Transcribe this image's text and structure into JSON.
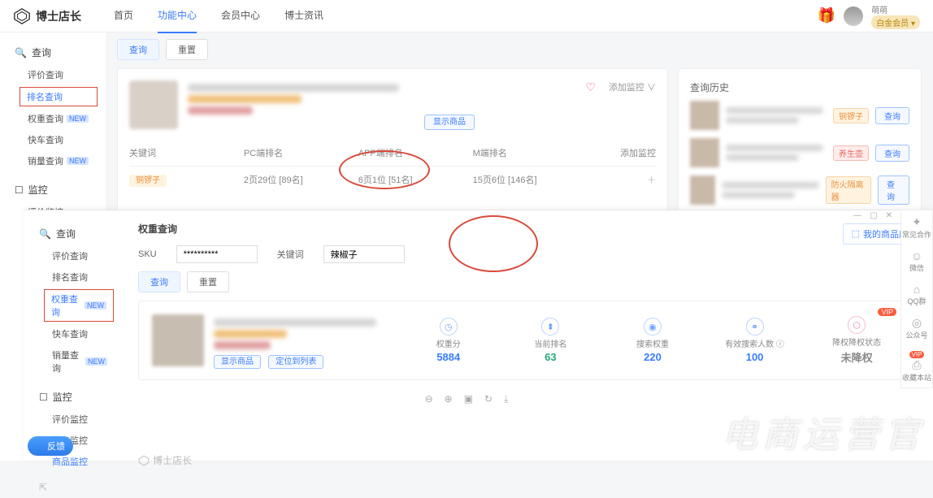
{
  "header": {
    "brand": "博士店长",
    "nav": [
      "首页",
      "功能中心",
      "会员中心",
      "博士资讯"
    ],
    "username": "萌萌",
    "member_badge": "白金会员 ▾"
  },
  "sidebar": {
    "group_query": "查询",
    "items_query": [
      {
        "label": "评价查询",
        "new": false
      },
      {
        "label": "排名查询",
        "new": false,
        "boxed": true,
        "active": true
      },
      {
        "label": "权重查询",
        "new": true
      },
      {
        "label": "快车查询",
        "new": false
      },
      {
        "label": "销量查询",
        "new": true
      }
    ],
    "group_monitor": "监控",
    "items_monitor": [
      {
        "label": "评价监控"
      },
      {
        "label": "排名监控"
      },
      {
        "label": "商品监控"
      }
    ]
  },
  "content": {
    "tabs": {
      "a": "查询",
      "b": "重置"
    },
    "show_product": "显示商品",
    "add_monitor": "添加监控 ∨",
    "table_headers": {
      "kw": "关键词",
      "pc": "PC端排名",
      "app": "APP端排名",
      "m": "M端排名",
      "act": "添加监控"
    },
    "table_row": {
      "kw_tag": "铜锣子",
      "pc": "2页29位 [89名]",
      "app": "6页1位 [51名]",
      "m": "15页6位 [146名]",
      "act": "＋"
    },
    "history": {
      "title": "查询历史",
      "items": [
        {
          "tag": "铜锣子",
          "btn": "查询"
        },
        {
          "tag": "养生壶",
          "btn": "查询"
        },
        {
          "tag": "防火隔离器",
          "btn": "查询"
        }
      ]
    }
  },
  "overlay": {
    "sidebar": {
      "group_query": "查询",
      "items_query": [
        {
          "label": "评价查询"
        },
        {
          "label": "排名查询"
        },
        {
          "label": "权重查询",
          "new": true,
          "boxed": true,
          "active": true
        },
        {
          "label": "快车查询"
        },
        {
          "label": "销量查询",
          "new": true
        }
      ],
      "group_monitor": "监控",
      "items_monitor": [
        {
          "label": "评价监控"
        },
        {
          "label": "排名监控"
        },
        {
          "label": "商品监控"
        }
      ]
    },
    "title": "权重查询",
    "my_products": "我的商品库",
    "form": {
      "sku_label": "SKU",
      "sku_value": "**********",
      "kw_label": "关键词",
      "kw_value": "辣椒子"
    },
    "btns": {
      "query": "查询",
      "reset": "重置"
    },
    "product_btns": {
      "show": "显示商品",
      "timeline": "定位到列表"
    },
    "stats": [
      {
        "label": "权重分",
        "value": "5884",
        "cls": ""
      },
      {
        "label": "当前排名",
        "value": "63",
        "cls": "green"
      },
      {
        "label": "搜索权重",
        "value": "220",
        "cls": ""
      },
      {
        "label": "有效搜索人数 ⓘ",
        "value": "100",
        "cls": ""
      },
      {
        "label": "降权降权状态",
        "value": "未降权",
        "cls": "gray",
        "vip": true
      }
    ],
    "footer_brand": "博士店长"
  },
  "dock": [
    {
      "icon": "✦",
      "label": "常见合作"
    },
    {
      "icon": "☺",
      "label": "微信"
    },
    {
      "icon": "⌂",
      "label": "QQ群"
    },
    {
      "icon": "◎",
      "label": "公众号"
    },
    {
      "icon": "⎙",
      "label": "收藏本站",
      "vip": true
    }
  ],
  "feedback": "反馈",
  "watermark": "电商运营官"
}
